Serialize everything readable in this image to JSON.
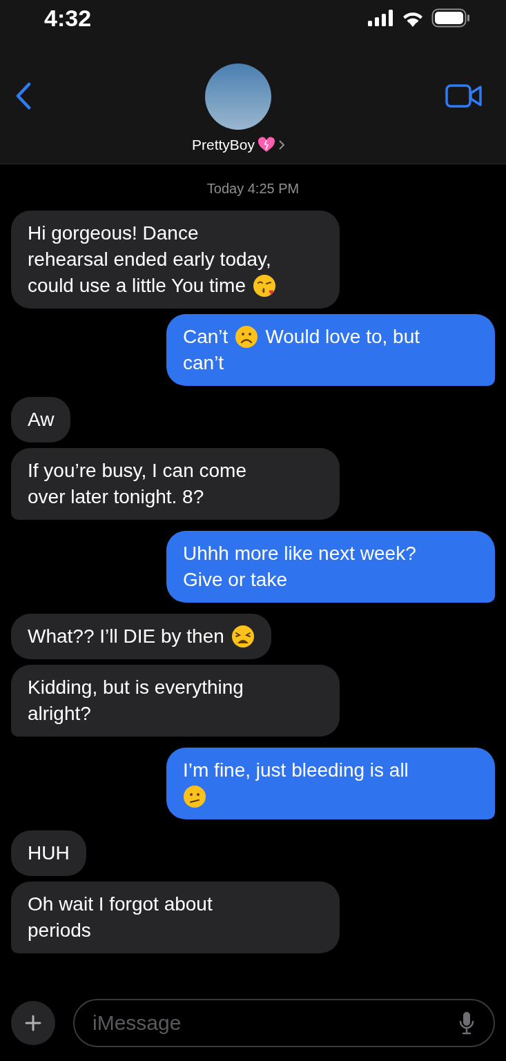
{
  "status_bar": {
    "time": "4:32"
  },
  "contact": {
    "name": "PrettyBoy"
  },
  "timestamp": "Today 4:25 PM",
  "messages": [
    {
      "outgoing": false,
      "tail": false,
      "lines": [
        [
          {
            "kind": "text",
            "text": "Hi gorgeous! Dance"
          }
        ],
        [
          {
            "kind": "text",
            "text": "rehearsal ended early today,"
          }
        ],
        [
          {
            "kind": "text",
            "text": "could use a little You time"
          },
          {
            "kind": "kiss"
          }
        ]
      ]
    },
    {
      "outgoing": true,
      "tail": true,
      "lines": [
        [
          {
            "kind": "text",
            "text": "Can’t"
          },
          {
            "kind": "frown"
          },
          {
            "kind": "text",
            "text": "Would love to, but"
          }
        ],
        [
          {
            "kind": "text",
            "text": "can’t"
          }
        ]
      ]
    },
    {
      "outgoing": false,
      "tail": false,
      "lines": [
        [
          {
            "kind": "text",
            "text": "Aw"
          }
        ]
      ]
    },
    {
      "outgoing": false,
      "tail": true,
      "lines": [
        [
          {
            "kind": "text",
            "text": "If you’re busy, I can come"
          }
        ],
        [
          {
            "kind": "text",
            "text": "over later tonight. 8?"
          }
        ]
      ]
    },
    {
      "outgoing": true,
      "tail": true,
      "lines": [
        [
          {
            "kind": "text",
            "text": "Uhhh more like next week?"
          }
        ],
        [
          {
            "kind": "text",
            "text": "Give or take"
          }
        ]
      ]
    },
    {
      "outgoing": false,
      "tail": false,
      "lines": [
        [
          {
            "kind": "text",
            "text": "What?? I’ll DIE by then"
          },
          {
            "kind": "weary"
          }
        ]
      ]
    },
    {
      "outgoing": false,
      "tail": true,
      "lines": [
        [
          {
            "kind": "text",
            "text": "Kidding, but is everything"
          }
        ],
        [
          {
            "kind": "text",
            "text": "alright?"
          }
        ]
      ]
    },
    {
      "outgoing": true,
      "tail": true,
      "lines": [
        [
          {
            "kind": "text",
            "text": "I’m fine, just bleeding is all"
          }
        ],
        [
          {
            "kind": "confused"
          }
        ]
      ]
    },
    {
      "outgoing": false,
      "tail": false,
      "lines": [
        [
          {
            "kind": "text",
            "text": "HUH"
          }
        ]
      ]
    },
    {
      "outgoing": false,
      "tail": true,
      "lines": [
        [
          {
            "kind": "text",
            "text": "Oh wait I forgot about"
          }
        ],
        [
          {
            "kind": "text",
            "text": "periods"
          }
        ]
      ]
    }
  ],
  "composer": {
    "placeholder": "iMessage"
  }
}
